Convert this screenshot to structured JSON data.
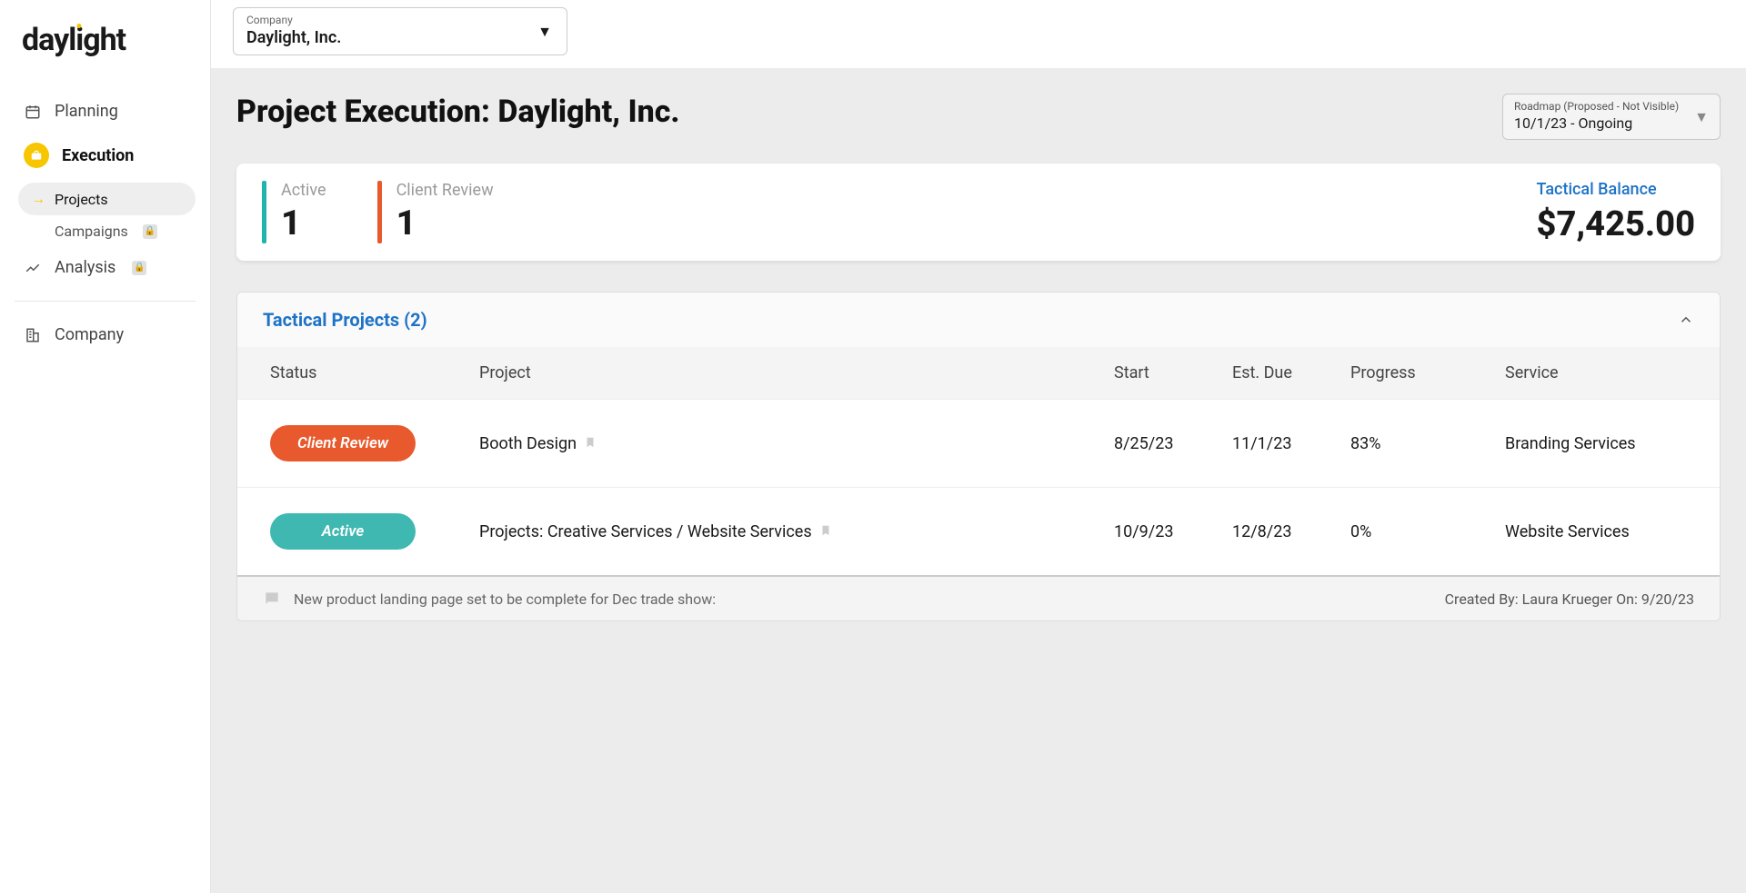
{
  "logo": "daylight",
  "nav": {
    "planning": "Planning",
    "execution": "Execution",
    "projects": "Projects",
    "campaigns": "Campaigns",
    "analysis": "Analysis",
    "company": "Company"
  },
  "topbar": {
    "company_label": "Company",
    "company_value": "Daylight, Inc."
  },
  "header": {
    "title": "Project Execution: Daylight, Inc.",
    "roadmap_label": "Roadmap (Proposed - Not Visible)",
    "roadmap_value": "10/1/23 - Ongoing"
  },
  "stats": {
    "active_label": "Active",
    "active_value": "1",
    "client_review_label": "Client Review",
    "client_review_value": "1",
    "balance_label": "Tactical Balance",
    "balance_value": "$7,425.00"
  },
  "section": {
    "title": "Tactical Projects (2)",
    "columns": {
      "status": "Status",
      "project": "Project",
      "start": "Start",
      "est_due": "Est. Due",
      "progress": "Progress",
      "service": "Service"
    },
    "rows": [
      {
        "status": "Client Review",
        "status_class": "pill-orange",
        "project": "Booth Design",
        "start": "8/25/23",
        "est_due": "11/1/23",
        "progress": "83%",
        "service": "Branding Services"
      },
      {
        "status": "Active",
        "status_class": "pill-teal",
        "project": "Projects: Creative Services / Website Services",
        "start": "10/9/23",
        "est_due": "12/8/23",
        "progress": "0%",
        "service": "Website Services"
      }
    ],
    "note": {
      "text": "New product landing page set to be complete for Dec trade show:",
      "meta": "Created By: Laura Krueger On: 9/20/23"
    }
  },
  "colors": {
    "teal": "#1fb5ad",
    "orange": "#e8592d"
  }
}
